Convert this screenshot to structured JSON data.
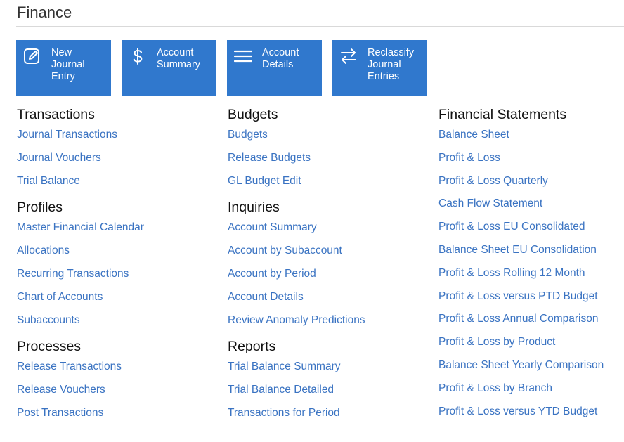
{
  "page": {
    "title": "Finance"
  },
  "tiles": [
    {
      "label": "New Journal Entry",
      "icon": "edit-icon"
    },
    {
      "label": "Account Summary",
      "icon": "dollar-icon"
    },
    {
      "label": "Account Details",
      "icon": "menu-lines-icon"
    },
    {
      "label": "Reclassify Journal Entries",
      "icon": "swap-arrows-icon"
    }
  ],
  "columns": {
    "col1": {
      "transactions": {
        "heading": "Transactions",
        "links": [
          "Journal Transactions",
          "Journal Vouchers",
          "Trial Balance"
        ]
      },
      "profiles": {
        "heading": "Profiles",
        "links": [
          "Master Financial Calendar",
          "Allocations",
          "Recurring Transactions",
          "Chart of Accounts",
          "Subaccounts"
        ]
      },
      "processes": {
        "heading": "Processes",
        "links": [
          "Release Transactions",
          "Release Vouchers",
          "Post Transactions"
        ]
      }
    },
    "col2": {
      "budgets": {
        "heading": "Budgets",
        "links": [
          "Budgets",
          "Release Budgets",
          "GL Budget Edit"
        ]
      },
      "inquiries": {
        "heading": "Inquiries",
        "links": [
          "Account Summary",
          "Account by Subaccount",
          "Account by Period",
          "Account Details",
          "Review Anomaly Predictions"
        ]
      },
      "reports": {
        "heading": "Reports",
        "links": [
          "Trial Balance Summary",
          "Trial Balance Detailed",
          "Transactions for Period"
        ]
      }
    },
    "col3": {
      "statements": {
        "heading": "Financial Statements",
        "links": [
          "Balance Sheet",
          "Profit & Loss",
          "Profit & Loss Quarterly",
          "Cash Flow Statement",
          "Profit & Loss EU Consolidated",
          "Balance Sheet EU Consolidation",
          "Profit & Loss Rolling 12 Month",
          "Profit & Loss versus PTD Budget",
          "Profit & Loss Annual Comparison",
          "Profit & Loss by Product",
          "Balance Sheet Yearly Comparison",
          "Profit & Loss by Branch",
          "Profit & Loss versus YTD Budget"
        ]
      }
    }
  },
  "colors": {
    "tile_background": "#3078cd",
    "link": "#3a73c2",
    "heading": "#111111"
  }
}
